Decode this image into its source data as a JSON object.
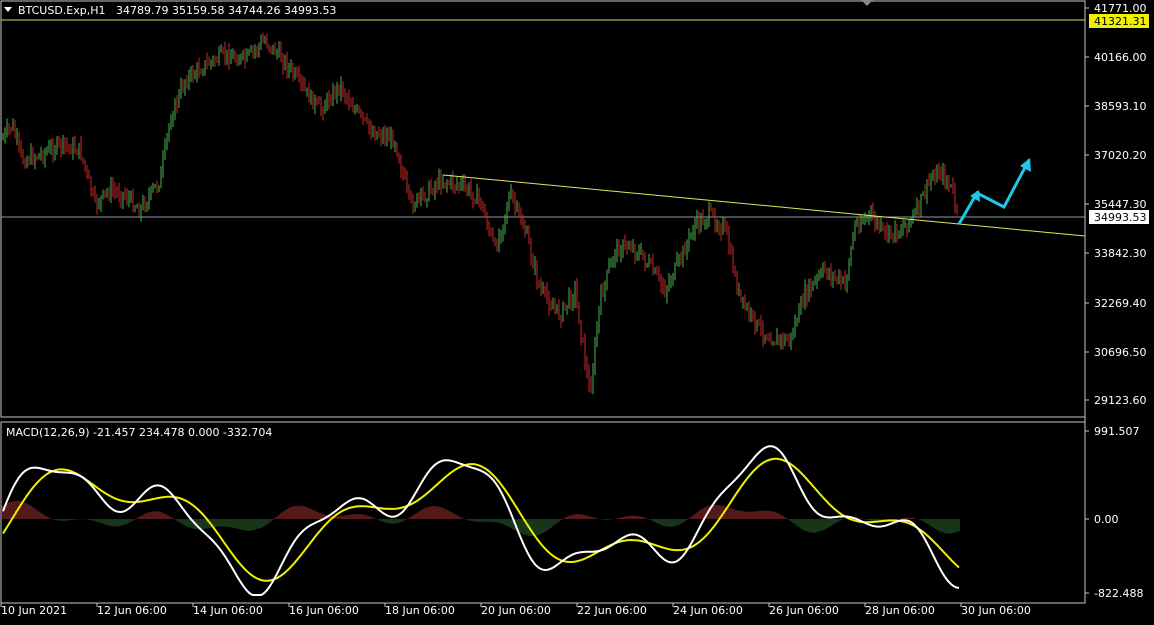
{
  "main_panel": {
    "symbol": "BTCUSD.Exp,H1",
    "ohlc": "34789.79 35159.58 34744.26 34993.53",
    "price_ticks": [
      "41771.00",
      "40166.00",
      "38593.10",
      "37020.20",
      "35447.30",
      "33842.30",
      "32269.40",
      "30696.50",
      "29123.60"
    ],
    "yellow_level_label": "41321.31",
    "current_price_label": "34993.53"
  },
  "indicator_panel": {
    "label": "MACD(12,26,9) -21.457 234.478 0.000 -332.704",
    "ticks": [
      "991.507",
      "0.00",
      "-822.488"
    ]
  },
  "time_axis": {
    "labels": [
      "10 Jun 2021",
      "12 Jun 06:00",
      "14 Jun 06:00",
      "16 Jun 06:00",
      "18 Jun 06:00",
      "20 Jun 06:00",
      "22 Jun 06:00",
      "24 Jun 06:00",
      "26 Jun 06:00",
      "28 Jun 06:00",
      "30 Jun 06:00"
    ]
  },
  "colors": {
    "background": "#000000",
    "bull": "#4caf50",
    "bear": "#c62828",
    "trendline": "#e6e65a",
    "forecast_arrow": "#1ec8e6",
    "macd_main": "#ffffff",
    "macd_signal": "#f0f000",
    "label_highlight": "#f0f000"
  },
  "icons": {
    "menu": "dropdown-triangle-icon",
    "scroll": "shift-marker-icon"
  }
}
